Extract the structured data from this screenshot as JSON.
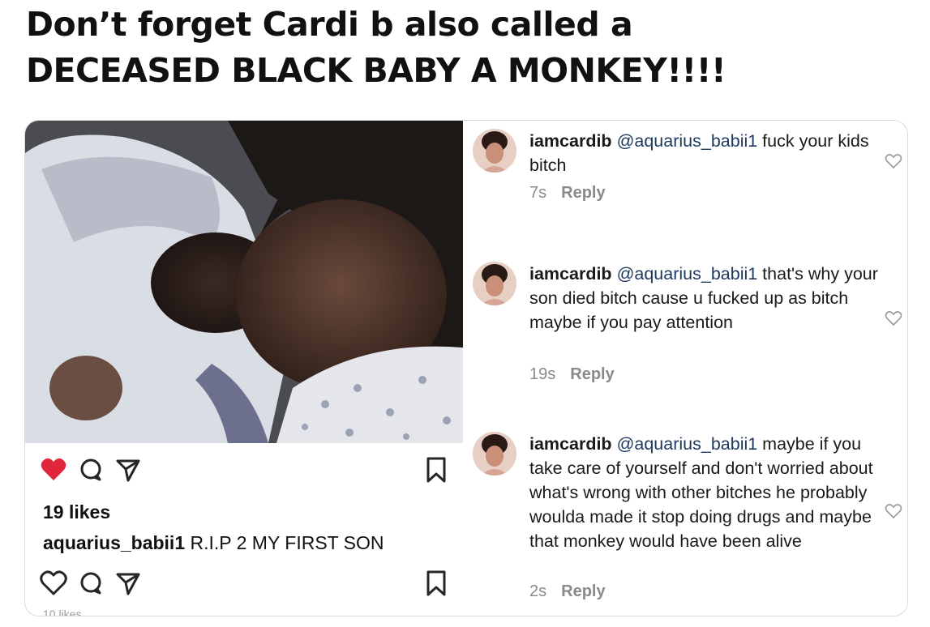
{
  "headline": {
    "line1": "Don’t forget Cardi b also called a",
    "line2": "DECEASED BLACK BABY A MONKEY!!!!"
  },
  "post": {
    "likes": "19 likes",
    "caption_user": "aquarius_babii1",
    "caption_text": " R.I.P 2 MY FIRST SON",
    "partial_text": "10 likes",
    "colors": {
      "liked_heart": "#e0263a",
      "icon_stroke": "#262626"
    },
    "icons": [
      "heart-filled-icon",
      "comment-icon",
      "share-icon",
      "bookmark-icon",
      "heart-outline-icon"
    ]
  },
  "comments": [
    {
      "handle": "iamcardib",
      "mention": "@aquarius_babii1",
      "text": " fuck your kids bitch",
      "time": "7s",
      "reply": "Reply"
    },
    {
      "handle": "iamcardib",
      "mention": "@aquarius_babii1",
      "text": " that's why your son died bitch cause u fucked up as bitch maybe if you pay attention",
      "time": "19s",
      "reply": "Reply"
    },
    {
      "handle": "iamcardib",
      "mention": "@aquarius_babii1",
      "text": " maybe if you take care of yourself and don't worried about what's wrong with other bitches he probably woulda made it stop doing drugs and maybe that monkey would have been alive",
      "time": "2s",
      "reply": "Reply"
    }
  ]
}
